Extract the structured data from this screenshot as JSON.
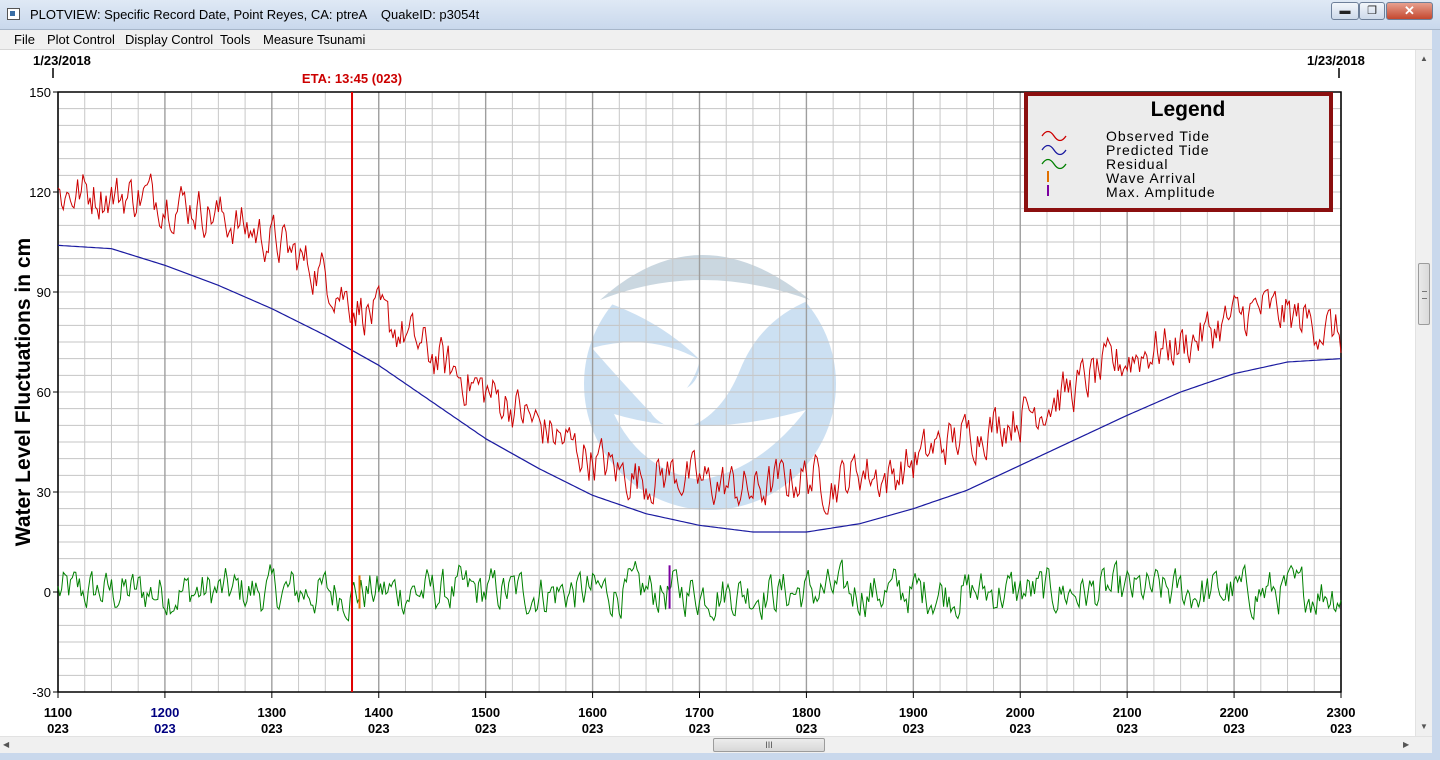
{
  "window": {
    "title": "PLOTVIEW: Specific Record Date, Point Reyes, CA: ptreA    QuakeID: p3054t",
    "min_glyph": "▬",
    "max_glyph": "❐",
    "close_glyph": "✕"
  },
  "menu": [
    "File",
    "Plot Control",
    "Display Control",
    "Tools",
    "Measure Tsunami"
  ],
  "dates": {
    "left": "1/23/2018",
    "right": "1/23/2018"
  },
  "eta": {
    "label": "ETA: 13:45 (023)",
    "time_hours": 13.75,
    "color": "#e00000"
  },
  "markers": {
    "wave_arrival": {
      "time_hours": 13.82,
      "color": "#e07000",
      "y_range": [
        -5,
        5
      ]
    },
    "max_amplitude": {
      "time_hours": 16.72,
      "color": "#7b00a0",
      "y_range": [
        -5,
        8
      ]
    }
  },
  "legend": {
    "title": "Legend",
    "items": [
      {
        "label": "Observed Tide",
        "color": "#cc0000",
        "symbol": "wave"
      },
      {
        "label": "Predicted Tide",
        "color": "#1a1aa0",
        "symbol": "wave"
      },
      {
        "label": "Residual",
        "color": "#008000",
        "symbol": "wave"
      },
      {
        "label": "Wave Arrival",
        "color": "#e07000",
        "symbol": "tick"
      },
      {
        "label": "Max. Amplitude",
        "color": "#7b00a0",
        "symbol": "tick"
      }
    ],
    "border_color": "#8b0f0f"
  },
  "hscroll_grip": "III",
  "chart_data": {
    "type": "line",
    "ylabel": "Water Level Fluctuations in cm",
    "xlim": [
      11,
      23
    ],
    "ylim": [
      -30,
      150
    ],
    "yticks": [
      -30,
      0,
      30,
      60,
      90,
      120,
      150
    ],
    "xticks": [
      {
        "time": "1100",
        "day": "023",
        "hour": 11,
        "color": "#000000"
      },
      {
        "time": "1200",
        "day": "023",
        "hour": 12,
        "color": "#000080"
      },
      {
        "time": "1300",
        "day": "023",
        "hour": 13,
        "color": "#000000"
      },
      {
        "time": "1400",
        "day": "023",
        "hour": 14,
        "color": "#000000"
      },
      {
        "time": "1500",
        "day": "023",
        "hour": 15,
        "color": "#000000"
      },
      {
        "time": "1600",
        "day": "023",
        "hour": 16,
        "color": "#000000"
      },
      {
        "time": "1700",
        "day": "023",
        "hour": 17,
        "color": "#000000"
      },
      {
        "time": "1800",
        "day": "023",
        "hour": 18,
        "color": "#000000"
      },
      {
        "time": "1900",
        "day": "023",
        "hour": 19,
        "color": "#000000"
      },
      {
        "time": "2000",
        "day": "023",
        "hour": 20,
        "color": "#000000"
      },
      {
        "time": "2100",
        "day": "023",
        "hour": 21,
        "color": "#000000"
      },
      {
        "time": "2200",
        "day": "023",
        "hour": 22,
        "color": "#000000"
      },
      {
        "time": "2300",
        "day": "023",
        "hour": 23,
        "color": "#000000"
      }
    ],
    "grid": true,
    "legend_position": "top-right",
    "series": [
      {
        "name": "Predicted Tide",
        "color": "#1a1aa0",
        "x": [
          11.0,
          11.5,
          12.0,
          12.5,
          13.0,
          13.5,
          14.0,
          14.5,
          15.0,
          15.5,
          16.0,
          16.5,
          17.0,
          17.5,
          18.0,
          18.5,
          19.0,
          19.5,
          20.0,
          20.5,
          21.0,
          21.5,
          22.0,
          22.5,
          23.0
        ],
        "y": [
          104.0,
          103.0,
          98.0,
          92.0,
          85.0,
          77.0,
          68.0,
          57.0,
          46.0,
          37.0,
          29.0,
          23.5,
          20.0,
          18.0,
          18.0,
          20.5,
          25.0,
          30.5,
          38.0,
          45.5,
          53.0,
          60.0,
          65.5,
          69.0,
          70.0
        ]
      },
      {
        "name": "Observed Tide",
        "color": "#cc0000",
        "x": [
          11.0,
          11.25,
          11.5,
          11.75,
          12.0,
          12.25,
          12.5,
          12.75,
          13.0,
          13.25,
          13.5,
          13.75,
          14.0,
          14.25,
          14.5,
          14.75,
          15.0,
          15.25,
          15.5,
          15.75,
          16.0,
          16.25,
          16.5,
          16.75,
          17.0,
          17.25,
          17.5,
          17.75,
          18.0,
          18.25,
          18.5,
          18.75,
          19.0,
          19.25,
          19.5,
          19.75,
          20.0,
          20.25,
          20.5,
          20.75,
          21.0,
          21.25,
          21.5,
          21.75,
          22.0,
          22.25,
          22.5,
          22.75,
          23.0
        ],
        "y": [
          119.0,
          120.0,
          119.0,
          119.0,
          118.0,
          116.0,
          113.0,
          109.0,
          106.0,
          100.0,
          95.0,
          87.0,
          82.0,
          77.0,
          71.0,
          65.0,
          60.0,
          56.0,
          50.0,
          45.0,
          40.0,
          36.0,
          34.0,
          36.0,
          33.0,
          32.0,
          30.0,
          33.0,
          35.0,
          32.0,
          37.0,
          34.0,
          39.0,
          44.0,
          47.0,
          50.0,
          53.0,
          57.0,
          61.0,
          66.0,
          70.0,
          73.0,
          74.0,
          78.0,
          82.0,
          85.0,
          83.0,
          81.0,
          77.0
        ]
      }
    ],
    "residual": {
      "name": "Residual",
      "color": "#008000",
      "approx_range": [
        -12,
        11
      ],
      "baseline": 0
    }
  }
}
